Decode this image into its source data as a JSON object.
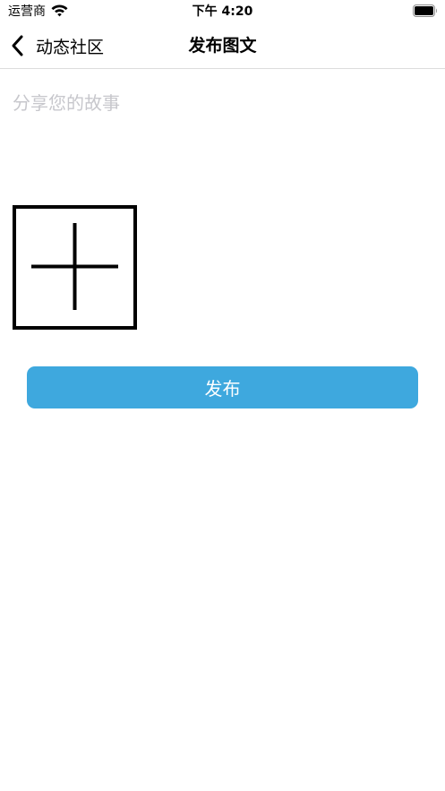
{
  "status_bar": {
    "carrier": "运营商",
    "time": "下午 4:20",
    "wifi_icon": "wifi-icon",
    "battery_icon": "battery-icon",
    "battery_level": 1.0
  },
  "nav": {
    "back_label": "动态社区",
    "back_icon": "chevron-left-icon",
    "title": "发布图文"
  },
  "compose": {
    "text_value": "",
    "placeholder": "分享您的故事",
    "add_image_icon": "plus-icon"
  },
  "publish_button": {
    "label": "发布",
    "color": "#3ea8de"
  }
}
